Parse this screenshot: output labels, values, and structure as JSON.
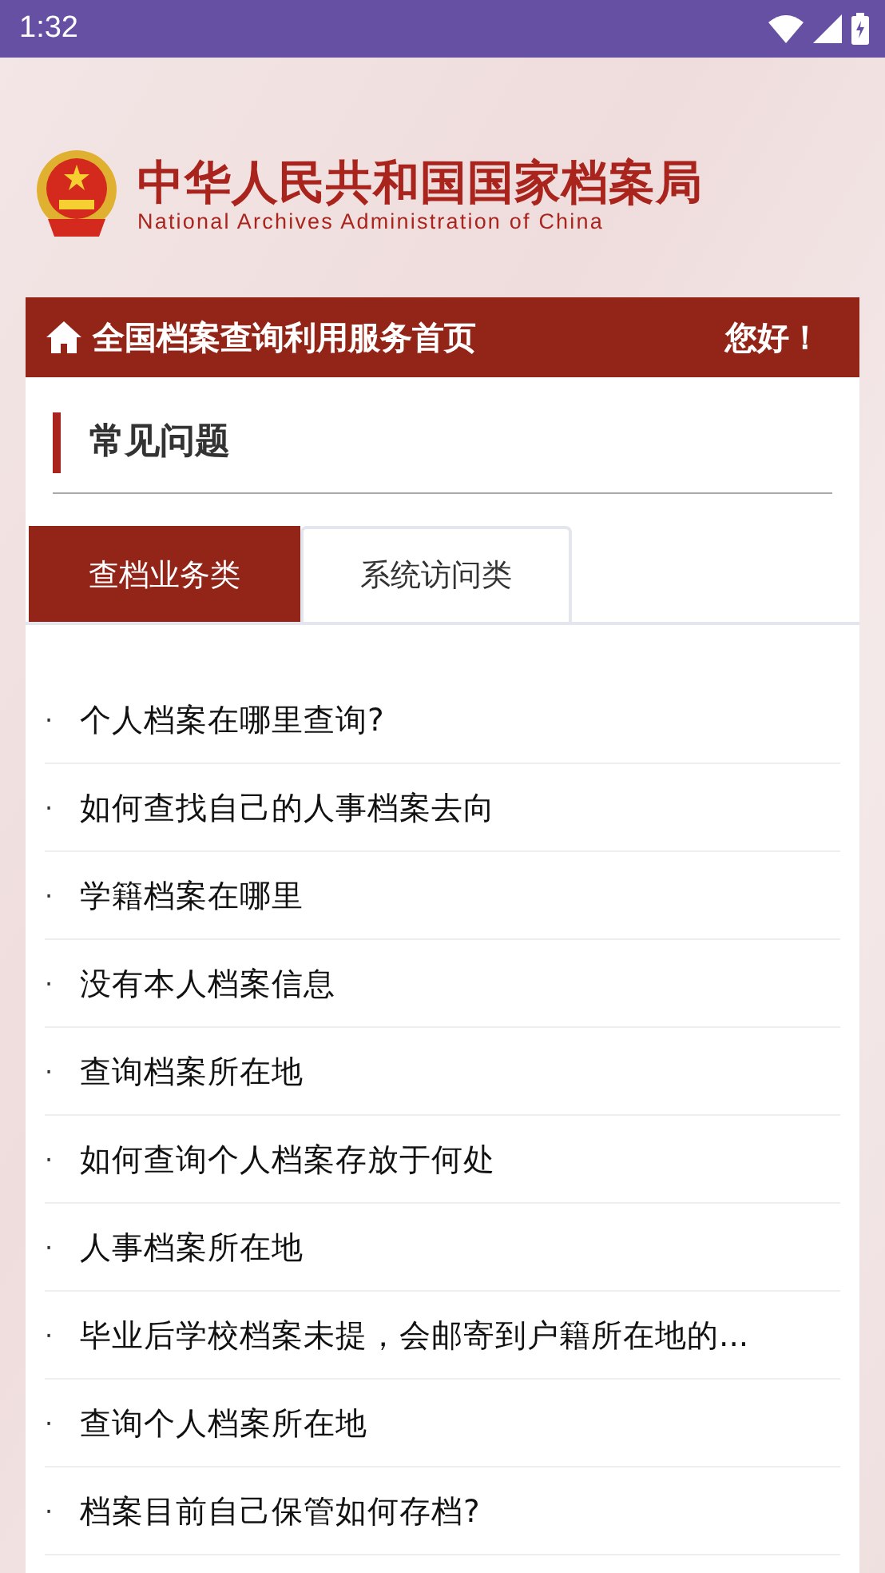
{
  "status_bar": {
    "time": "1:32"
  },
  "header": {
    "title": "中华人民共和国国家档案局",
    "subtitle": "National Archives Administration of China"
  },
  "nav_bar": {
    "title": "全国档案查询利用服务首页",
    "greeting": "您好！"
  },
  "section": {
    "title": "常见问题"
  },
  "tabs": [
    {
      "label": "查档业务类",
      "selected": true
    },
    {
      "label": "系统访问类",
      "selected": false
    }
  ],
  "questions": [
    {
      "bullet": "·",
      "text": "个人档案在哪里查询?"
    },
    {
      "bullet": "·",
      "text": "如何查找自己的人事档案去向"
    },
    {
      "bullet": "·",
      "text": "学籍档案在哪里"
    },
    {
      "bullet": "·",
      "text": "没有本人档案信息"
    },
    {
      "bullet": "·",
      "text": "查询档案所在地"
    },
    {
      "bullet": "·",
      "text": "如何查询个人档案存放于何处"
    },
    {
      "bullet": "·",
      "text": "人事档案所在地"
    },
    {
      "bullet": "·",
      "text": "毕业后学校档案未提，会邮寄到户籍所在地的..."
    },
    {
      "bullet": "·",
      "text": "查询个人档案所在地"
    },
    {
      "bullet": "·",
      "text": "档案目前自己保管如何存档?"
    }
  ]
}
